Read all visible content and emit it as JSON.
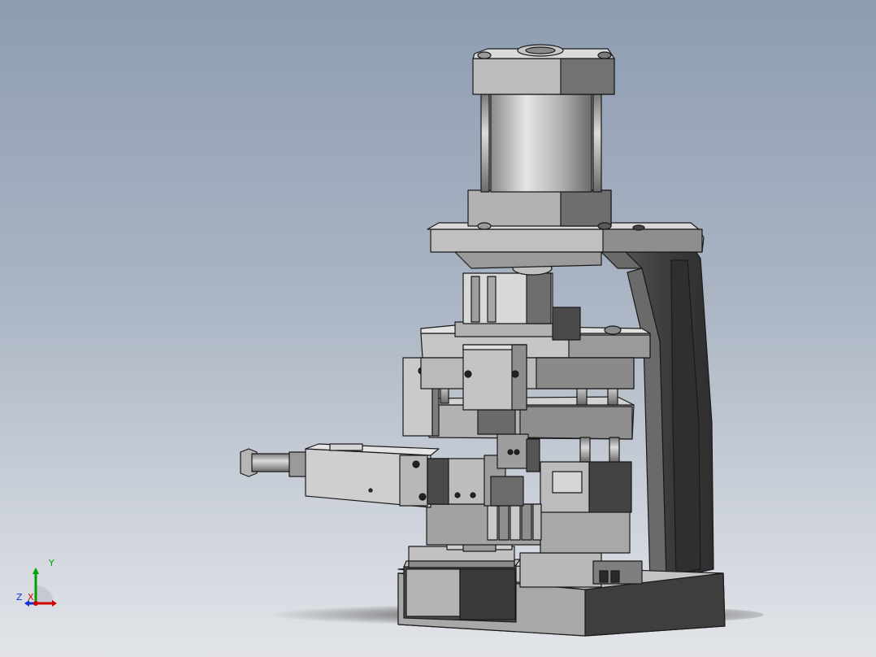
{
  "viewport": {
    "background_top": "#8e9db2",
    "background_bottom": "#e2e4e8"
  },
  "model": {
    "icon": "pneumatic-press-assembly",
    "colors": {
      "steel_light": "#c8c8c8",
      "steel_mid": "#a6a6a6",
      "steel_dark": "#6e6e6e",
      "frame_dark": "#3e3e3e",
      "edge": "#1a1a1a",
      "shadow": "#3a3a3a"
    }
  },
  "triad": {
    "icon": "coordinate-triad-icon",
    "x_label": "X",
    "y_label": "Y",
    "z_label": "Z",
    "x_color": "#d00000",
    "y_color": "#00a000",
    "z_color": "#1030d0"
  }
}
